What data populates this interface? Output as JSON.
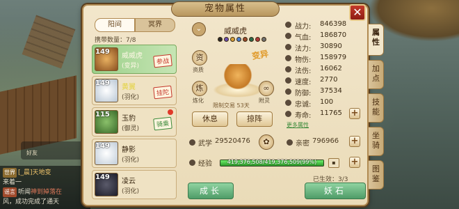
{
  "window": {
    "title": "宠物属性",
    "close_glyph": "✕"
  },
  "background_chat": {
    "mini_label": "好友",
    "lines": [
      {
        "tag": "世界",
        "text": "[_晨]天地变",
        "tag_color": "#8a6a2f"
      },
      {
        "text": "来着一"
      },
      {
        "tag": "谣言",
        "text": "听闻",
        "highlight": "神到掉落在",
        "tag_color": "#a04a2c"
      },
      {
        "text": "风，成功完成了通天"
      }
    ]
  },
  "tabs": [
    {
      "label": "阳间",
      "active": true
    },
    {
      "label": "冥界",
      "active": false
    }
  ],
  "carry": {
    "label": "携带数量：",
    "value": "7/8"
  },
  "pets": [
    {
      "level": "149",
      "name": "威威虎",
      "type": "(变异)",
      "badge": "参战",
      "badge_color": "red",
      "selected": true,
      "avatar_color": "#c98a3a"
    },
    {
      "level": "149",
      "name": "黄翼",
      "type": "(羽化)",
      "badge": "挂陀",
      "badge_color": "red",
      "selected": false,
      "name_yellow": true,
      "avatar_color": "#dfe6ee"
    },
    {
      "level": "115",
      "name": "玉豹",
      "type": "(御灵)",
      "badge": "骑乘",
      "badge_color": "green",
      "selected": false,
      "red_dot": true,
      "avatar_color": "#6aa04a"
    },
    {
      "level": "149",
      "name": "静影",
      "type": "(羽化)",
      "badge": "",
      "selected": false,
      "avatar_color": "#e6edf2"
    },
    {
      "level": "149",
      "name": "凌云",
      "type": "(羽化)",
      "badge": "",
      "selected": false,
      "avatar_color": "#3a3a48"
    }
  ],
  "center": {
    "expand_glyph": "⌄",
    "pet_name": "威威虎",
    "variant_label": "变异",
    "left_icons": [
      {
        "glyph": "资",
        "caption": "资质"
      },
      {
        "glyph": "炼",
        "caption": "炼化"
      }
    ],
    "right_icons": [
      {
        "glyph": "◎",
        "caption": ""
      },
      {
        "glyph": "∞",
        "caption": "附灵"
      }
    ],
    "trade_lock": "限制交易 53天",
    "rest_button": "休息",
    "arrange_button": "掠阵",
    "skill_colors": [
      "#2a2a2a",
      "#6a4fb0",
      "#d9a23a",
      "#4a7fd0",
      "#9a4a2a",
      "#2a6a4a",
      "#b03a3a",
      "#707070"
    ]
  },
  "stats": [
    {
      "label": "战力:",
      "value": "846398"
    },
    {
      "label": "气血:",
      "value": "186870"
    },
    {
      "label": "法力:",
      "value": "30890"
    },
    {
      "label": "物伤:",
      "value": "158979"
    },
    {
      "label": "法伤:",
      "value": "16062"
    },
    {
      "label": "速度:",
      "value": "2770"
    },
    {
      "label": "防御:",
      "value": "37534"
    },
    {
      "label": "忠诚:",
      "value": "100"
    },
    {
      "label": "寿命:",
      "value": "11765"
    }
  ],
  "more_attrs": "更多属性",
  "martial": {
    "label": "武学",
    "value": "29520476"
  },
  "intimacy": {
    "label": "亲密",
    "value": "796966"
  },
  "exp": {
    "label": "经验",
    "text": "419,376,508/419,376,509(99%)",
    "percent": 99.9
  },
  "effective": {
    "label": "已生效：",
    "value": "3/3"
  },
  "bottom_buttons": {
    "grow": "成长",
    "demon_stone": "妖石"
  },
  "side_tabs": [
    {
      "label": "属性",
      "active": true
    },
    {
      "label": "加点",
      "active": false
    },
    {
      "label": "技能",
      "active": false
    },
    {
      "label": "坐骑",
      "active": false
    },
    {
      "label": "图鉴",
      "active": false
    }
  ]
}
